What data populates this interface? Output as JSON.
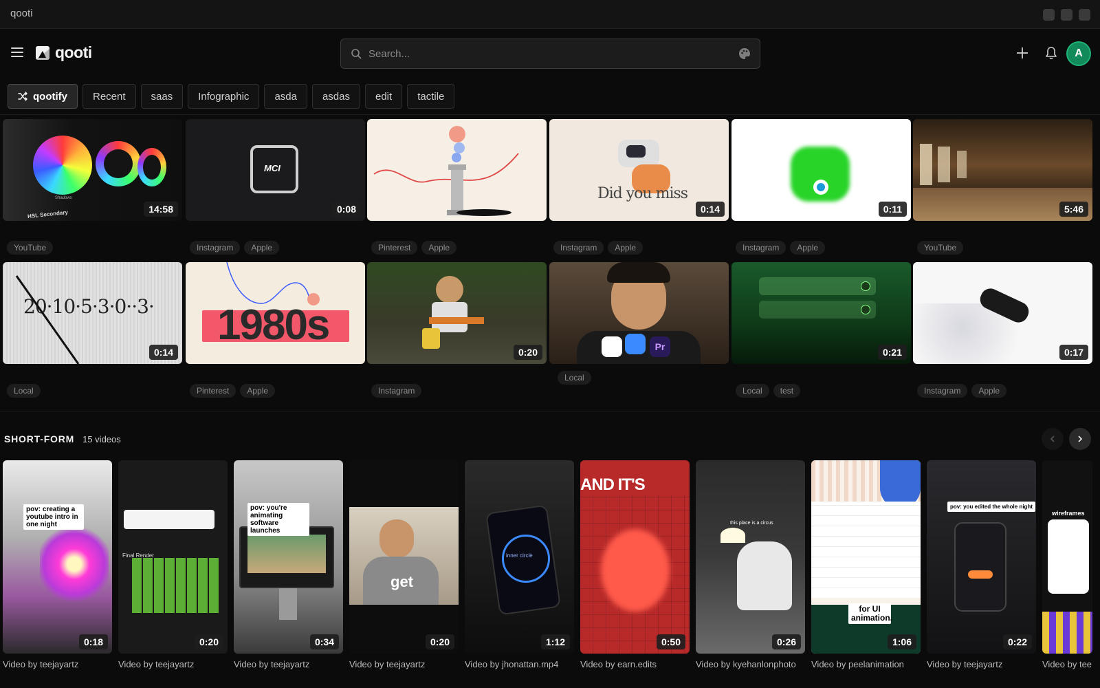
{
  "window": {
    "title": "qooti"
  },
  "header": {
    "logo_text": "qooti",
    "search_placeholder": "Search...",
    "avatar_initial": "A",
    "accent": "#128a5a"
  },
  "tabs": [
    {
      "label": "qootify",
      "icon": "shuffle-icon",
      "active": true
    },
    {
      "label": "Recent"
    },
    {
      "label": "saas"
    },
    {
      "label": "Infographic"
    },
    {
      "label": "asda"
    },
    {
      "label": "asdas"
    },
    {
      "label": "edit"
    },
    {
      "label": "tactile"
    }
  ],
  "grid": [
    {
      "duration": "14:58",
      "tags": [
        "YouTube"
      ]
    },
    {
      "duration": "0:08",
      "tags": [
        "Instagram",
        "Apple"
      ]
    },
    {
      "duration": "",
      "tags": [
        "Pinterest",
        "Apple"
      ]
    },
    {
      "duration": "0:14",
      "tags": [
        "Instagram",
        "Apple"
      ]
    },
    {
      "duration": "0:11",
      "tags": [
        "Instagram",
        "Apple"
      ]
    },
    {
      "duration": "5:46",
      "tags": [
        "YouTube"
      ]
    },
    {
      "duration": "0:14",
      "tags": [
        "Local"
      ]
    },
    {
      "duration": "",
      "tags": [
        "Pinterest",
        "Apple"
      ]
    },
    {
      "duration": "0:20",
      "tags": [
        "Instagram"
      ]
    },
    {
      "duration": "",
      "tags": [
        "Local"
      ]
    },
    {
      "duration": "0:21",
      "tags": [
        "Local",
        "test"
      ]
    },
    {
      "duration": "0:17",
      "tags": [
        "Instagram",
        "Apple"
      ]
    }
  ],
  "thumb_text": {
    "hsl": "HSL Secondary",
    "shadows": "Shadows",
    "mci": "MCI",
    "did_you_miss": "Did you miss",
    "ruler": "20·10·5·3·0··3·",
    "eighties": "1980s"
  },
  "short_form": {
    "title": "SHORT-FORM",
    "count": "15 videos",
    "videos": [
      {
        "duration": "0:18",
        "caption": "Video by teejayartz",
        "overlay": "pov: creating a youtube intro in one night"
      },
      {
        "duration": "0:20",
        "caption": "Video by teejayartz",
        "overlay": "Final Render"
      },
      {
        "duration": "0:34",
        "caption": "Video by teejayartz",
        "overlay": "pov: you're animating software launches"
      },
      {
        "duration": "0:20",
        "caption": "Video by teejayartz",
        "overlay": "get"
      },
      {
        "duration": "1:12",
        "caption": "Video by jhonattan.mp4",
        "overlay": "inner circle"
      },
      {
        "duration": "0:50",
        "caption": "Video by earn.edits",
        "overlay": "AND IT'S"
      },
      {
        "duration": "0:26",
        "caption": "Video by kyehanlonphoto",
        "overlay": "this place is a circus"
      },
      {
        "duration": "1:06",
        "caption": "Video by peelanimation",
        "overlay": "for UI animation."
      },
      {
        "duration": "0:22",
        "caption": "Video by teejayartz",
        "overlay": "pov: you edited the whole night"
      },
      {
        "duration": "",
        "caption": "Video by tee",
        "overlay": "wireframes"
      }
    ]
  }
}
